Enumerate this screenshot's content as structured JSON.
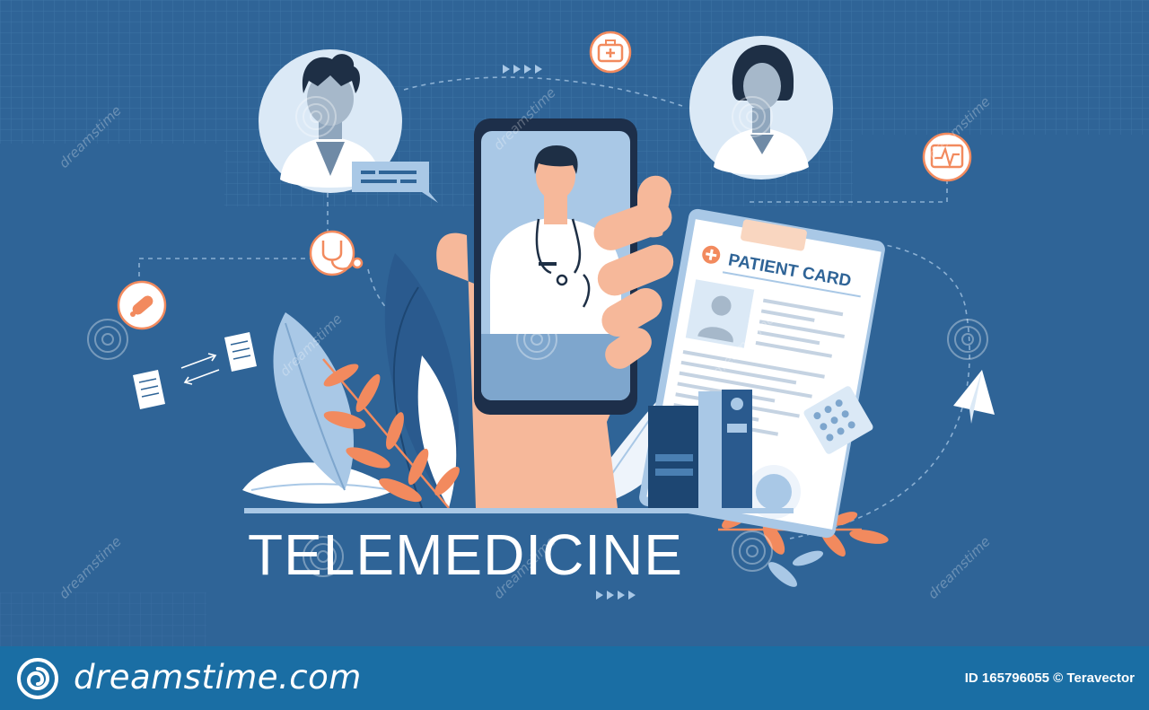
{
  "scene": {
    "title": "TELEMEDICINE",
    "patient_card_label": "PATIENT CARD",
    "watermark_text": "dreamstime"
  },
  "footer": {
    "brand": "dreamstime.com",
    "credit": "ID 165796055 © Teravector"
  },
  "colors": {
    "background": "#2f6497",
    "footer": "#1a6ea4",
    "accent_orange": "#f28a5e",
    "light_blue": "#a9c8e6",
    "skin": "#f6b89a"
  },
  "icons": [
    "doctor-avatar-man",
    "doctor-avatar-woman",
    "first-aid-kit-icon",
    "heart-monitor-icon",
    "stethoscope-icon",
    "pill-capsule-icon",
    "document-icon",
    "paper-plane-icon",
    "chat-bubble-icon"
  ]
}
